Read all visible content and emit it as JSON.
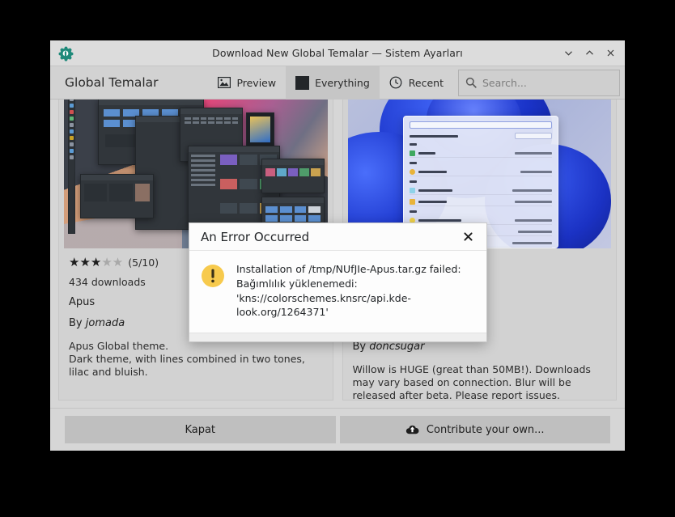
{
  "window": {
    "title": "Download New Global Temalar — Sistem Ayarları",
    "app_icon": "system-settings-icon",
    "controls": {
      "minimize": "chevron-down-icon",
      "maximize": "chevron-up-icon",
      "close": "close-icon"
    }
  },
  "toolbar": {
    "title": "Global Temalar",
    "view_buttons": [
      {
        "label": "Preview",
        "icon": "image-preview-icon",
        "active": false
      },
      {
        "label": "Everything",
        "icon": "filled-square-icon",
        "active": true
      },
      {
        "label": "Recent",
        "icon": "clock-icon",
        "active": false
      }
    ],
    "search": {
      "placeholder": "Search...",
      "value": "",
      "icon": "search-icon"
    }
  },
  "items": [
    {
      "thumbnail": "apus-dark-desktop-screenshot",
      "stars_filled": 3,
      "stars_total": 5,
      "rating_text": "(5/10)",
      "downloads": "434 downloads",
      "name": "Apus",
      "author_prefix": "By ",
      "author": "jomada",
      "description": "Apus Global theme.\nDark theme, with lines combined in two tones, lilac and bluish."
    },
    {
      "thumbnail": "willow-windows11-desktop-screenshot",
      "stars_filled": 0,
      "stars_total": 0,
      "rating_text": "",
      "downloads": "",
      "name": "",
      "author_prefix": "By ",
      "author": "doncsugar",
      "description": "Willow is HUGE (great than 50MB!). Downloads may vary based on connection. Blur will be released after beta. Please report issues."
    }
  ],
  "buttons": {
    "close_label": "Kapat",
    "contribute_label": "Contribute your own...",
    "contribute_icon": "upload-cloud-icon"
  },
  "error_dialog": {
    "title": "An Error Occurred",
    "close_icon": "close-icon",
    "warning_icon": "warning-exclamation-icon",
    "message": "Installation of /tmp/NUfJIe-Apus.tar.gz failed: Bağımlılık yüklenemedi: 'kns://colorschemes.knsrc/api.kde-look.org/1264371'"
  },
  "colors": {
    "accent_teal": "#1f8a7a",
    "warning_yellow": "#f7ca4d",
    "window_bg": "#d6d6d6",
    "card_bg": "#d2d2d2",
    "button_bg": "#bfbfbf",
    "titlebar_bg": "#dcdcdc"
  }
}
